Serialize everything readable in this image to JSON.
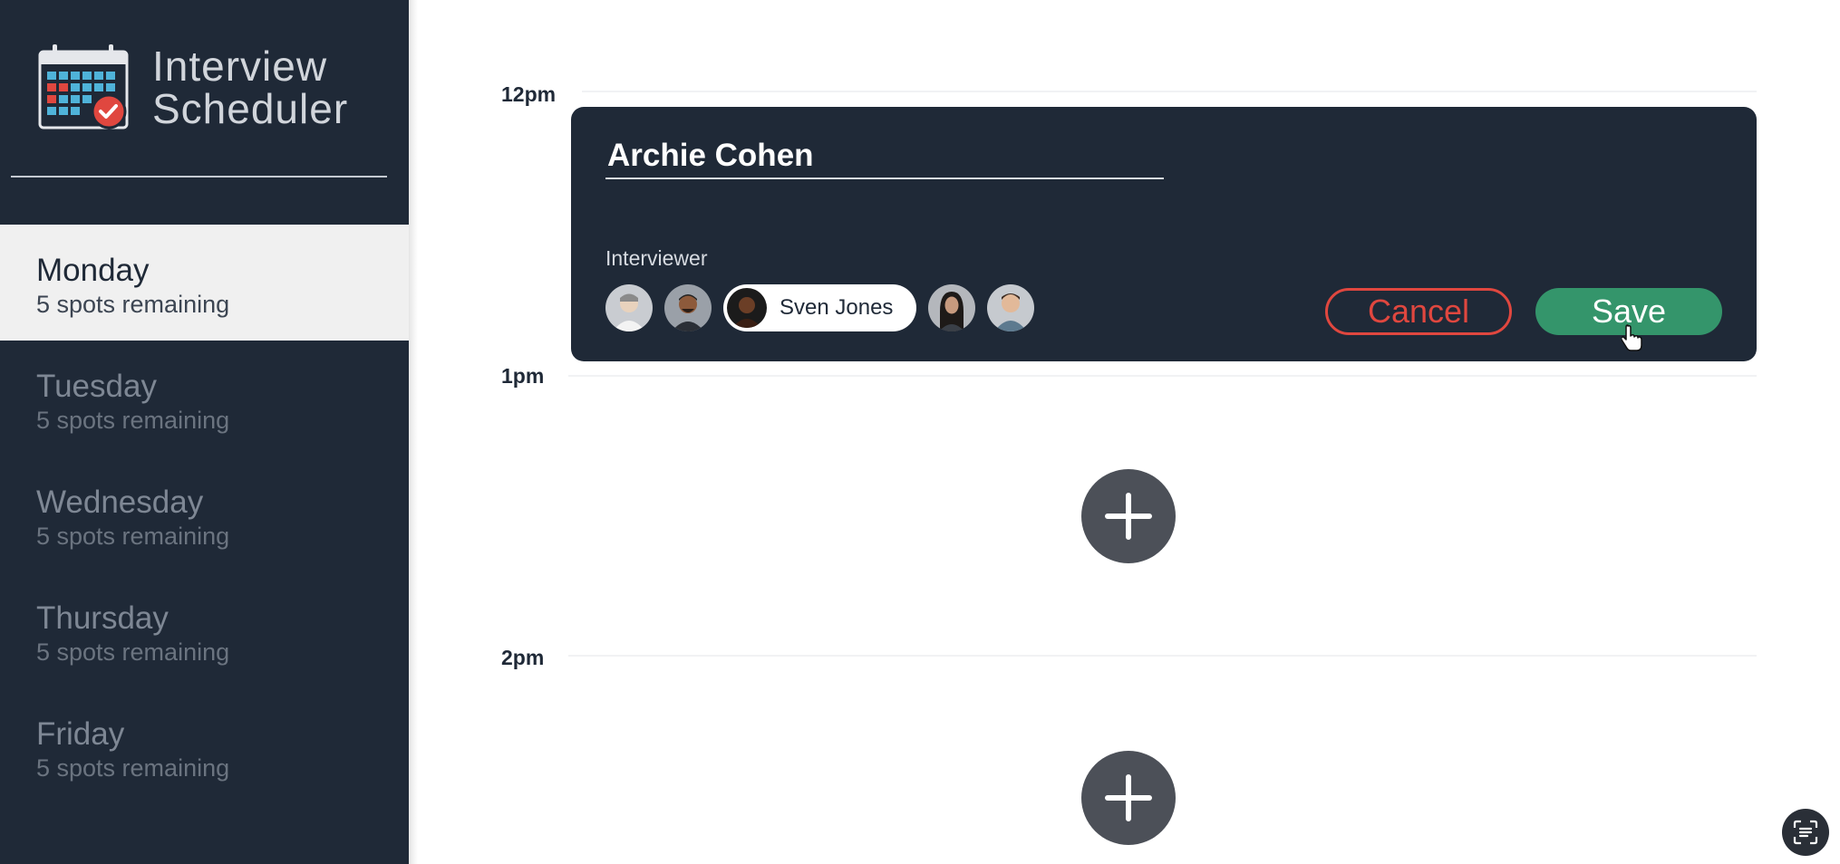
{
  "app": {
    "title": "Interview\nScheduler",
    "logo_icon": "calendar-check-icon"
  },
  "sidebar": {
    "days": [
      {
        "name": "Monday",
        "spots": "5 spots remaining",
        "active": true
      },
      {
        "name": "Tuesday",
        "spots": "5 spots remaining",
        "active": false
      },
      {
        "name": "Wednesday",
        "spots": "5 spots remaining",
        "active": false
      },
      {
        "name": "Thursday",
        "spots": "5 spots remaining",
        "active": false
      },
      {
        "name": "Friday",
        "spots": "5 spots remaining",
        "active": false
      }
    ]
  },
  "schedule": {
    "times": [
      "12pm",
      "1pm",
      "2pm"
    ],
    "form": {
      "student_name": "Archie Cohen",
      "interviewer_label": "Interviewer",
      "selected_interviewer": "Sven Jones",
      "interviewer_avatars": [
        "avatar-1",
        "avatar-2",
        "avatar-3-selected",
        "avatar-4",
        "avatar-5"
      ],
      "cancel_label": "Cancel",
      "save_label": "Save"
    },
    "add_icon": "plus-icon"
  },
  "colors": {
    "sidebar_bg": "#1f2937",
    "cancel": "#e0473f",
    "save": "#34956b",
    "add_button": "#4c5058"
  }
}
